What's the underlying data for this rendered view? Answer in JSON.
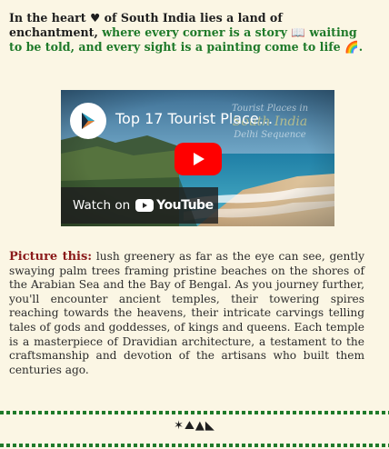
{
  "intro": {
    "part1": "In the heart ",
    "heart_glyph": "♥",
    "part2": " of South India lies a land of enchantment, ",
    "green1": "where every corner is a story ",
    "book_glyph": "📖",
    "green2": " waiting to be told, and every sight is a painting come to life ",
    "rainbow_glyph": "🌈",
    "end": "."
  },
  "video": {
    "title": "Top 17 Tourist Place...",
    "overlay_line1": "Tourist Places in",
    "overlay_line2": "South India",
    "overlay_line3": "Delhi Sequence",
    "watch_label": "Watch on",
    "youtube_word": "YouTube"
  },
  "paragraph": {
    "lead": "Picture this:",
    "body": " lush greenery as far as the eye can see, gently swaying palm trees framing pristine beaches on the shores of the Arabian Sea and the Bay of Bengal. As you journey further, you'll encounter ancient temples, their towering spires reaching towards the heavens, their intricate carvings telling tales of gods and goddesses, of kings and queens. Each temple is a masterpiece of Dravidian architecture, a testament to the craftsmanship and devotion of the artisans who built them centuries ago."
  },
  "footer": {
    "icons": "✶⛰▲◣"
  },
  "colors": {
    "background": "#fbf6e4",
    "accent_green": "#1f7a2a",
    "lead_red": "#8b1a1a",
    "youtube_red": "#ff0000"
  }
}
